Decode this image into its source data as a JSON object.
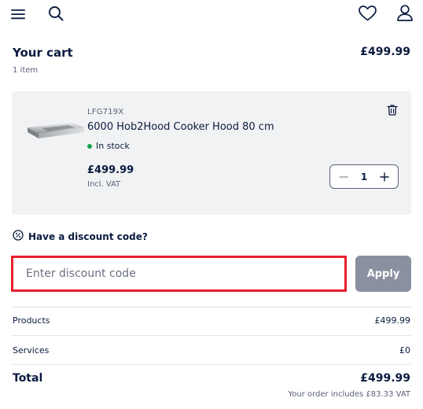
{
  "header": {
    "menu_icon": "hamburger-menu-icon",
    "search_icon": "search-icon",
    "wishlist_icon": "heart-icon",
    "account_icon": "user-icon"
  },
  "cart": {
    "title": "Your cart",
    "item_count": "1 item",
    "total": "£499.99"
  },
  "item": {
    "sku": "LFG719X",
    "name": "6000 Hob2Hood Cooker Hood 80 cm",
    "stock_status": "In stock",
    "stock_color": "#1aa34a",
    "price": "£499.99",
    "vat_note": "Incl. VAT",
    "quantity": "1",
    "delete_icon": "trash-icon"
  },
  "discount": {
    "heading": "Have a discount code?",
    "placeholder": "Enter discount code",
    "value": "",
    "apply_label": "Apply",
    "highlight_color": "#e8202f",
    "button_color": "#8a90a0"
  },
  "summary": {
    "products_label": "Products",
    "products_value": "£499.99",
    "services_label": "Services",
    "services_value": "£0",
    "total_label": "Total",
    "total_value": "£499.99",
    "vat_included": "Your order includes £83.33 VAT"
  }
}
